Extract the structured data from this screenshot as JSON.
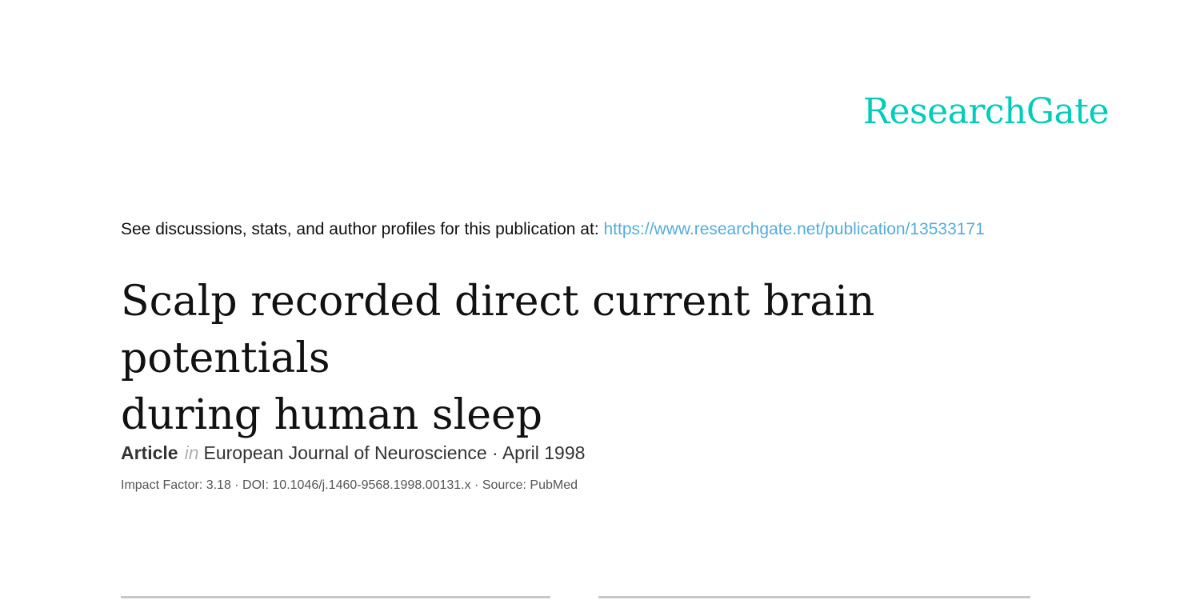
{
  "brand": {
    "logo_text": "ResearchGate",
    "color": "#00ccbb"
  },
  "discussion": {
    "lead_text": "See discussions, stats, and author profiles for this publication at: ",
    "link_text": "https://www.researchgate.net/publication/13533171",
    "link_color": "#55acdc"
  },
  "publication": {
    "title_line1": "Scalp recorded direct current brain potentials",
    "title_line2": "during human sleep",
    "type": "Article",
    "in_word": "in",
    "venue_date": "European Journal of Neuroscience · April 1998",
    "details": "Impact Factor: 3.18 · DOI: 10.1046/j.1460-9568.1998.00131.x · Source: PubMed"
  }
}
